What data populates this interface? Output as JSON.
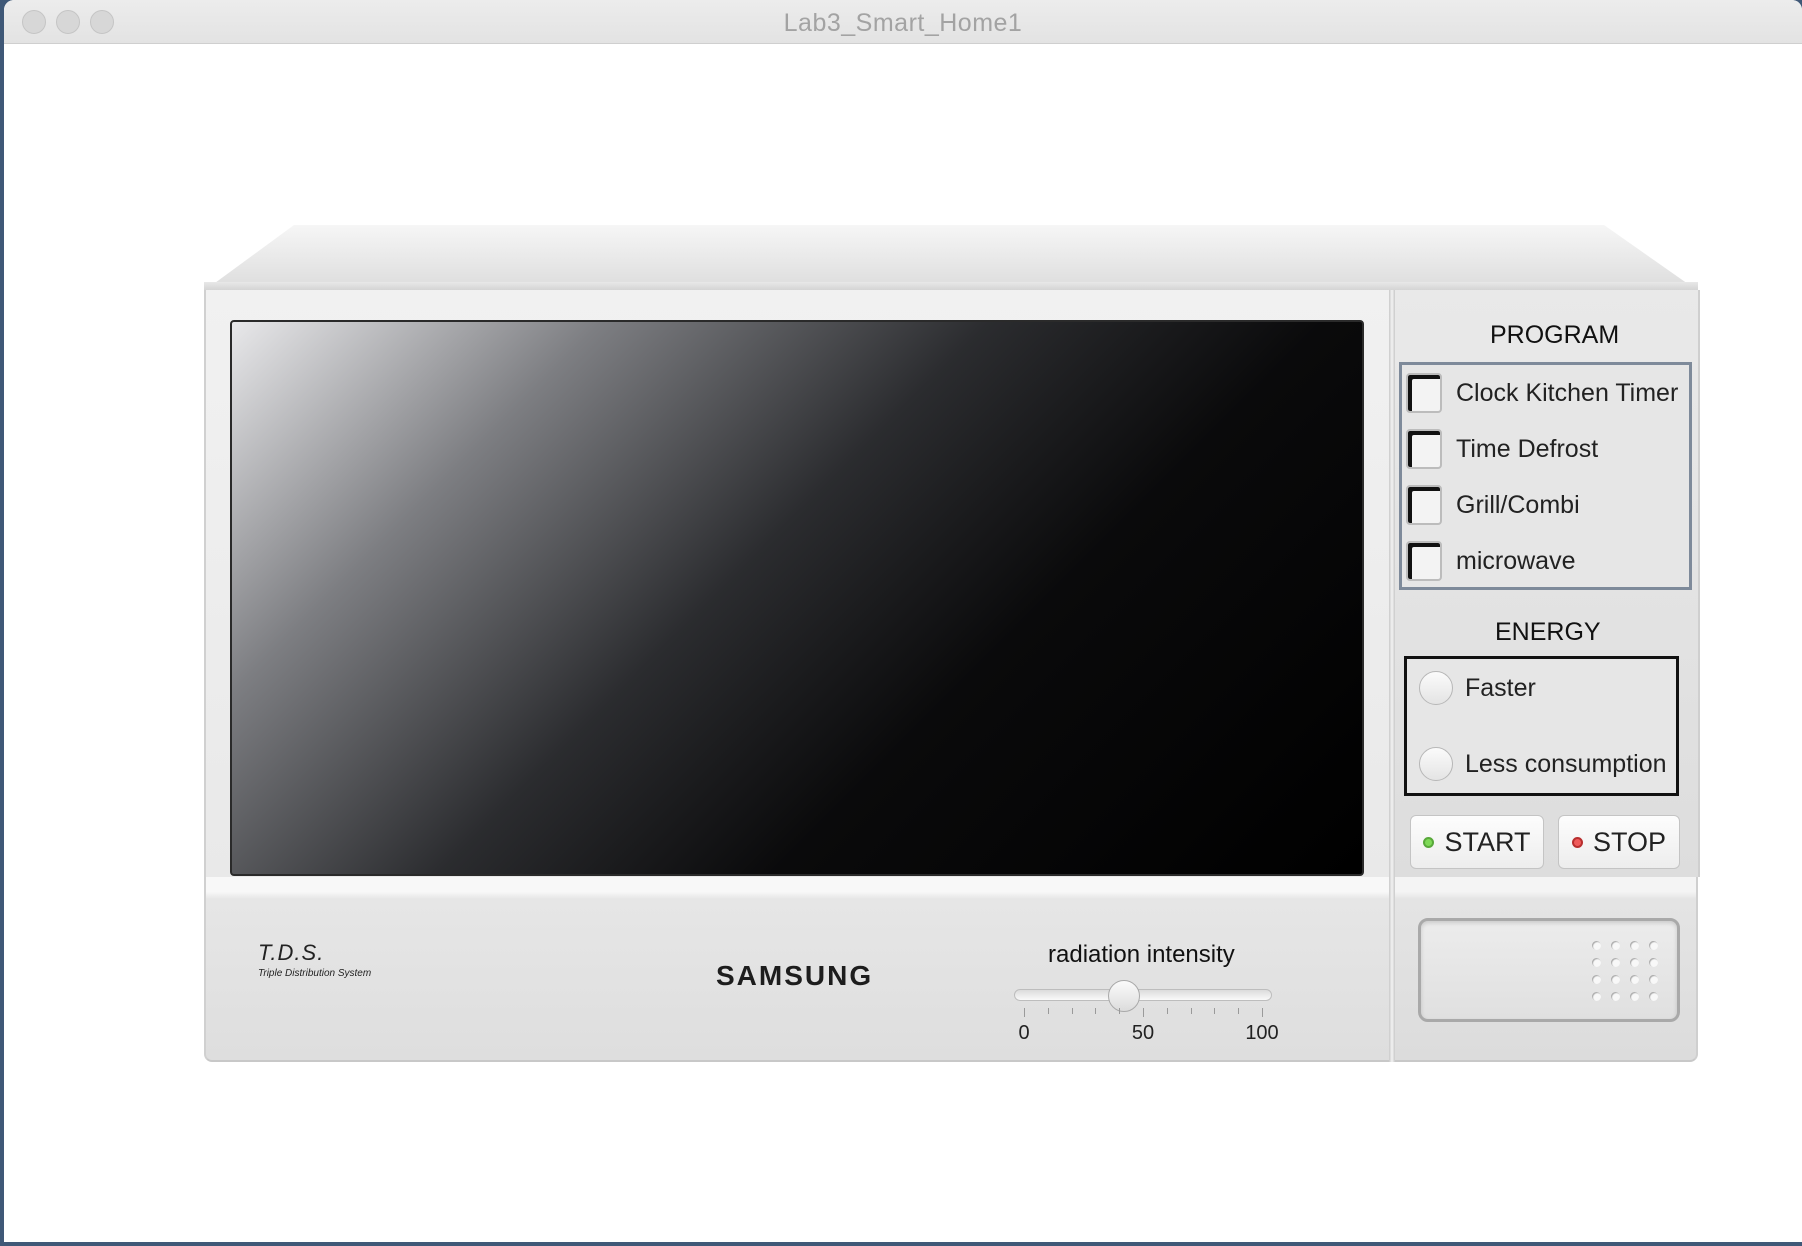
{
  "window": {
    "title": "Lab3_Smart_Home1"
  },
  "program": {
    "title": "PROGRAM",
    "options": [
      "Clock Kitchen Timer",
      "Time Defrost",
      "Grill/Combi",
      "microwave"
    ]
  },
  "energy": {
    "title": "ENERGY",
    "options": [
      "Faster",
      "Less consumption"
    ]
  },
  "buttons": {
    "start": "START",
    "stop": "STOP"
  },
  "branding": {
    "tds": "T.D.S.",
    "tds_sub": "Triple Distribution System",
    "brand": "SAMSUNG"
  },
  "slider": {
    "label": "radiation intensity",
    "min": 0,
    "max": 100,
    "value": 42,
    "ticks": [
      "0",
      "50",
      "100"
    ]
  }
}
